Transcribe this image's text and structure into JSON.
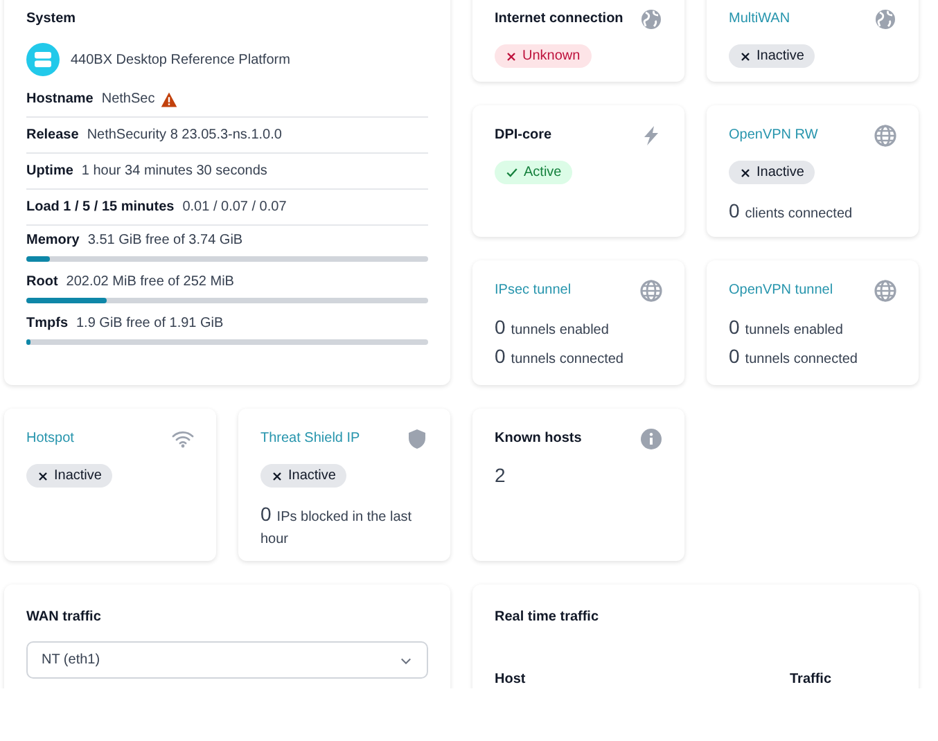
{
  "system": {
    "title": "System",
    "platform": "440BX Desktop Reference Platform",
    "rows": [
      {
        "kind": "text",
        "label": "Hostname",
        "value": "NethSec",
        "warning": true
      },
      {
        "kind": "text",
        "label": "Release",
        "value": "NethSecurity 8 23.05.3-ns.1.0.0",
        "warning": false
      },
      {
        "kind": "text",
        "label": "Uptime",
        "value": "1 hour 34 minutes 30 seconds",
        "warning": false
      },
      {
        "kind": "text",
        "label": "Load 1 / 5 / 15 minutes",
        "value": "0.01 / 0.07 / 0.07",
        "warning": false
      },
      {
        "kind": "meter",
        "label": "Memory",
        "value": "3.51 GiB free of 3.74 GiB",
        "level": 0.06
      },
      {
        "kind": "meter",
        "label": "Root",
        "value": "202.02 MiB free of 252 MiB",
        "level": 0.2
      },
      {
        "kind": "meter",
        "label": "Tmpfs",
        "value": "1.9 GiB free of 1.91 GiB",
        "level": 0.01
      }
    ]
  },
  "cards": [
    {
      "title": "Internet connection",
      "link": false,
      "status": {
        "kind": "error",
        "label": "Unknown"
      }
    },
    {
      "title": "MultiWAN",
      "link": true,
      "status": {
        "kind": "neutral",
        "label": "Inactive"
      }
    },
    {
      "title": "DPI-core",
      "link": false,
      "status": {
        "kind": "success",
        "label": "Active"
      }
    },
    {
      "title": "OpenVPN RW",
      "link": true,
      "status": {
        "kind": "neutral",
        "label": "Inactive"
      },
      "counters": [
        {
          "value": "0",
          "label": "clients connected"
        }
      ]
    },
    {
      "title": "IPsec tunnel",
      "link": true,
      "counters": [
        {
          "value": "0",
          "label": "tunnels enabled"
        },
        {
          "value": "0",
          "label": "tunnels connected"
        }
      ]
    },
    {
      "title": "OpenVPN tunnel",
      "link": true,
      "counters": [
        {
          "value": "0",
          "label": "tunnels enabled"
        },
        {
          "value": "0",
          "label": "tunnels connected"
        }
      ]
    },
    {
      "title": "Hotspot",
      "link": true,
      "status": {
        "kind": "neutral",
        "label": "Inactive"
      }
    },
    {
      "title": "Threat Shield IP",
      "link": true,
      "status": {
        "kind": "neutral",
        "label": "Inactive"
      },
      "counters": [
        {
          "value": "0",
          "label": "IPs blocked in the last hour"
        }
      ]
    },
    {
      "title": "Known hosts",
      "link": false,
      "value": "2"
    }
  ],
  "wan_traffic": {
    "title": "WAN traffic",
    "selected_interface": "NT (eth1)"
  },
  "real_time_traffic": {
    "title": "Real time traffic",
    "columns": [
      "Host",
      "Traffic"
    ]
  }
}
